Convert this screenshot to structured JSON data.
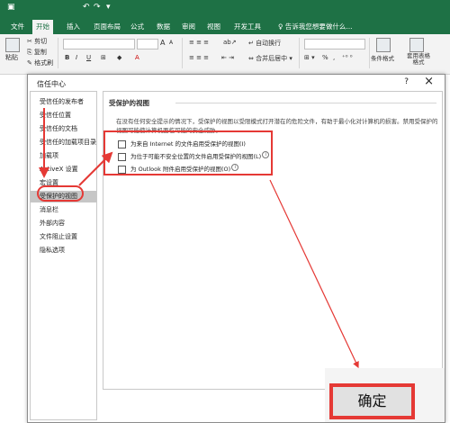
{
  "ribbon": {
    "tabs": [
      "文件",
      "开始",
      "插入",
      "页面布局",
      "公式",
      "数据",
      "审阅",
      "视图",
      "开发工具"
    ],
    "active_tab": "开始",
    "tell_me": "告诉我您想要做什么...",
    "clipboard": {
      "paste": "粘贴",
      "cut": "剪切",
      "copy": "复制",
      "format_painter": "格式刷"
    },
    "font": {
      "bold": "B",
      "italic": "I",
      "underline": "U",
      "grow": "A",
      "shrink": "A"
    },
    "alignment": {
      "wrap_text": "自动换行",
      "merge_center": "合并后居中"
    },
    "number": {
      "percent": "%",
      "comma": ","
    },
    "styles": {
      "conditional_format": "条件格式",
      "table_format": "套用表格格式"
    }
  },
  "dialog": {
    "title": "信任中心",
    "help": "?",
    "close": "×",
    "sidebar": [
      "受信任的发布者",
      "受信任位置",
      "受信任的文档",
      "受信任的加载项目录",
      "加载项",
      "ActiveX 设置",
      "宏设置",
      "受保护的视图",
      "消息栏",
      "外部内容",
      "文件阻止设置",
      "隐私选项"
    ],
    "selected_index": 7,
    "section_title": "受保护的视图",
    "description": "在没有任何安全提示的情况下，受保护的视图以受限模式打开潜在的危险文件，有助于最小化对计算机的损害。禁用受保护的视图可能使计算机面临可能的安全威胁。",
    "options": [
      {
        "label": "为来自 Internet 的文件启用受保护的视图(I)",
        "checked": false
      },
      {
        "label": "为位于可能不安全位置的文件启用受保护的视图(L)",
        "checked": false
      },
      {
        "label": "为 Outlook 附件启用受保护的视图(O)",
        "checked": false
      }
    ],
    "info_icon": "i",
    "ok_label": "确定"
  },
  "colors": {
    "excel_green": "#1e7145",
    "annotation_red": "#e53935",
    "selected_gray": "#c6c6c6"
  }
}
